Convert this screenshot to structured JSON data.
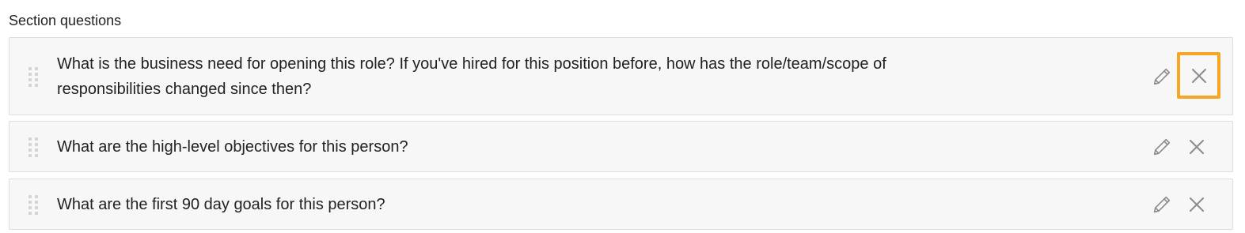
{
  "section": {
    "title": "Section questions"
  },
  "questions": [
    {
      "text": "What is the business need for opening this role? If you've hired for this position before, how has the role/team/scope of responsibilities changed since then?",
      "highlighted_remove": true
    },
    {
      "text": "What are the high-level objectives for this person?",
      "highlighted_remove": false
    },
    {
      "text": "What are the first 90 day goals for this person?",
      "highlighted_remove": false
    }
  ],
  "icons": {
    "drag": "drag-handle-icon",
    "edit": "pencil-icon",
    "remove": "close-icon"
  },
  "colors": {
    "card_background": "#f7f7f7",
    "card_border": "#dedede",
    "icon_gray": "#8c8c8c",
    "highlight_orange": "#f5a623"
  }
}
